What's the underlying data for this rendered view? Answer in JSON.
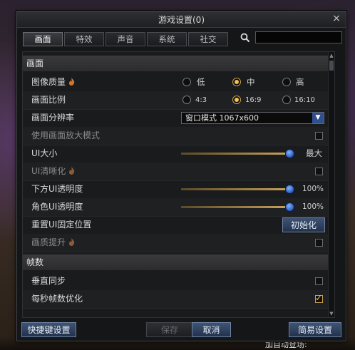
{
  "window": {
    "title": "游戏设置(0)",
    "close_symbol": "×"
  },
  "tabs": [
    {
      "label": "画面",
      "active": true
    },
    {
      "label": "特效",
      "active": false
    },
    {
      "label": "声音",
      "active": false
    },
    {
      "label": "系统",
      "active": false
    },
    {
      "label": "社交",
      "active": false
    }
  ],
  "search": {
    "value": "",
    "placeholder": ""
  },
  "sections": {
    "display": "画面",
    "fps": "帧数"
  },
  "quality": {
    "label": "图像质量",
    "options": [
      "低",
      "中",
      "高"
    ],
    "selected": "中"
  },
  "aspect": {
    "label": "画面比例",
    "options": [
      "4:3",
      "16:9",
      "16:10"
    ],
    "selected": "16:9"
  },
  "resolution": {
    "label": "画面分辨率",
    "value": "窗口模式 1067x600"
  },
  "zoom": {
    "label": "使用画面放大模式",
    "checked": false
  },
  "ui_size": {
    "label": "UI大小",
    "level": 1.0,
    "value_text": "最大"
  },
  "ui_sharpness": {
    "label": "UI清晰化",
    "checked": false
  },
  "bottom_ui_opacity": {
    "label": "下方UI透明度",
    "level": 100,
    "value_text": "100%"
  },
  "char_ui_opacity": {
    "label": "角色UI透明度",
    "level": 100,
    "value_text": "100%"
  },
  "reset_ui": {
    "label": "重置UI固定位置",
    "button": "初始化"
  },
  "quality_boost": {
    "label": "画质提升",
    "checked": false
  },
  "vsync": {
    "label": "垂直同步",
    "checked": false
  },
  "fps_opt": {
    "label": "每秒帧数优化",
    "checked": true
  },
  "footer": {
    "shortcut": "快捷键设置",
    "save": "保存",
    "cancel": "取消",
    "simple": "简易设置"
  },
  "background": {
    "footer_text": "加自动登场:"
  },
  "colors": {
    "accent": "#f2c34f",
    "panel": "#1a1b1d",
    "button": "#2f4f8f"
  }
}
